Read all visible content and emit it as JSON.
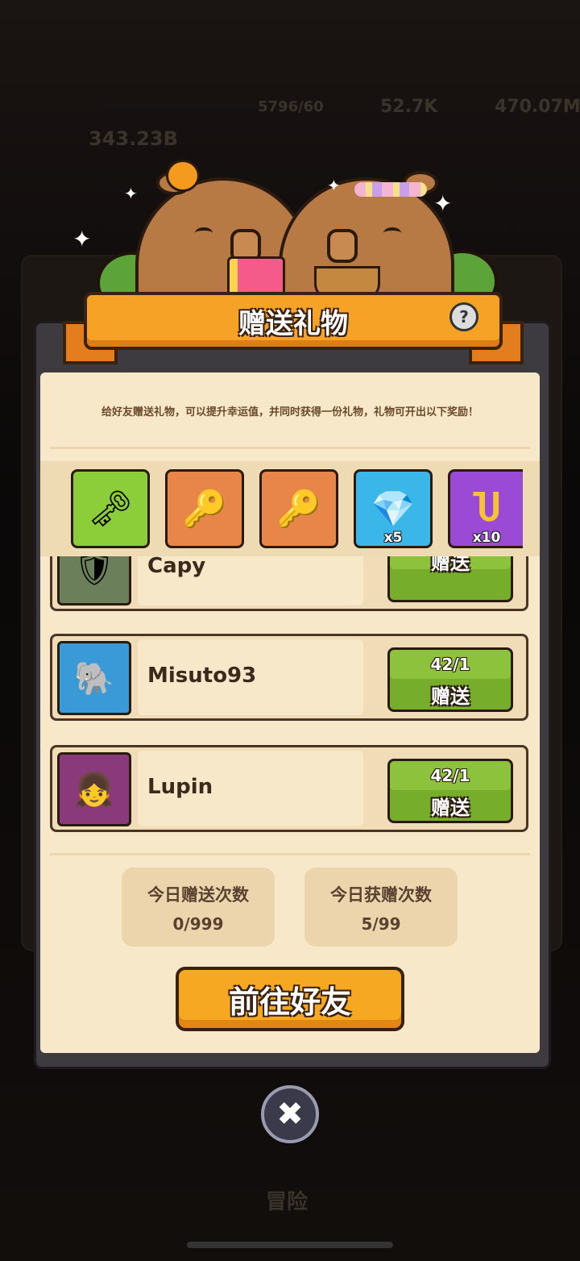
{
  "background": {
    "ghost_texts": [
      "5796/60",
      "52.7K",
      "470.07M",
      "343.23B",
      "冒险"
    ]
  },
  "dialog": {
    "title": "赠送礼物",
    "help_icon": "question-icon",
    "description": "给好友赠送礼物，可以提升幸运值，并同时获得一份礼物，礼物可开出以下奖励！"
  },
  "rewards": [
    {
      "icon": "silver-key-icon",
      "glyph": "🗝",
      "qty": "",
      "color": "#8ccd3a"
    },
    {
      "icon": "gold-key-icon",
      "glyph": "🔑",
      "qty": "",
      "color": "#e8864a"
    },
    {
      "icon": "gem-key-icon",
      "glyph": "🔑",
      "qty": "",
      "color": "#e8864a"
    },
    {
      "icon": "crystal-icon",
      "glyph": "💎",
      "qty": "x5",
      "color": "#3ab6e8"
    },
    {
      "icon": "horseshoe-icon",
      "glyph": "Ⴎ",
      "qty": "x10",
      "color": "#9a4ad4"
    }
  ],
  "friends": [
    {
      "name": "Capy",
      "count": "",
      "send_label": "赠送"
    },
    {
      "name": "Misuto93",
      "count": "42/1",
      "send_label": "赠送"
    },
    {
      "name": "Lupin",
      "count": "42/1",
      "send_label": "赠送"
    }
  ],
  "stats": {
    "sent": {
      "label": "今日赠送次数",
      "value": "0/999"
    },
    "received": {
      "label": "今日获赠次数",
      "value": "5/99"
    }
  },
  "go_button": "前往好友",
  "close_icon": "close-icon"
}
